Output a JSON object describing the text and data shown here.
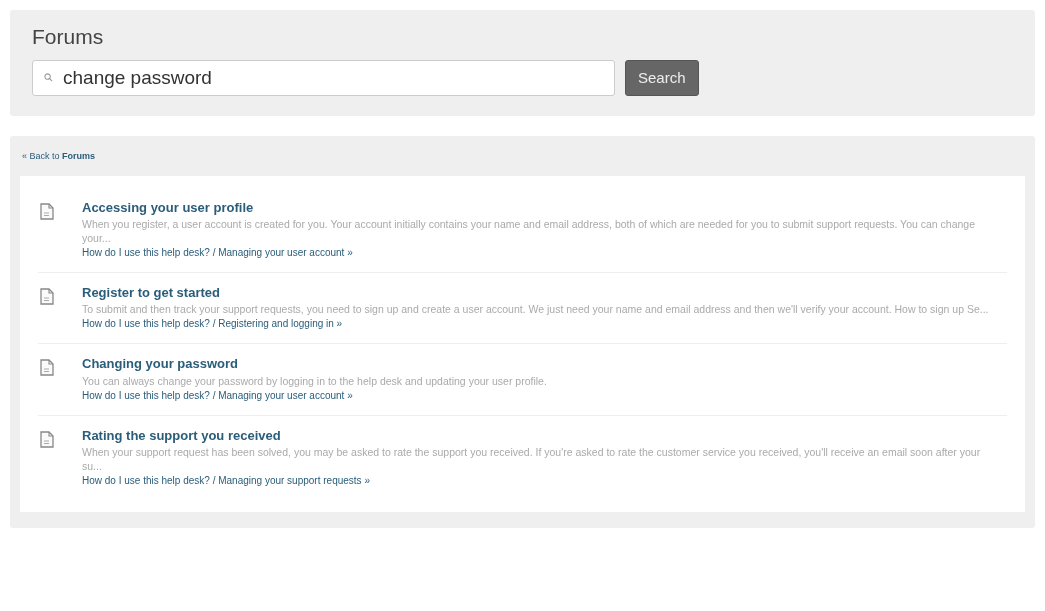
{
  "header": {
    "title": "Forums",
    "search": {
      "value": "change password"
    },
    "search_button": "Search"
  },
  "back_link": "« Back to **Forums**",
  "results": [
    {
      "title": "Accessing your user profile",
      "snippet": "When you register, a user account is created for you. Your account initially contains your name and email address, both of which are needed for you to submit support requests. You can change your...",
      "path": "How do I use this help desk? / Managing your user account »"
    },
    {
      "title": "Register to get started",
      "snippet": "To submit and then track your support requests, you need to sign up and create a user account. We just need your name and email address and then we'll verify your account. How to sign up Se...",
      "path": "How do I use this help desk? / Registering and logging in »"
    },
    {
      "title": "Changing your password",
      "snippet": "You can always change your password by logging in to the help desk and updating your user profile.",
      "path": "How do I use this help desk? / Managing your user account »"
    },
    {
      "title": "Rating the support you received",
      "snippet": "When your support request has been solved, you may be asked to rate the support you received. If you're asked to rate the customer service you received, you'll receive an email soon after your su...",
      "path": "How do I use this help desk? / Managing your support requests »"
    }
  ]
}
